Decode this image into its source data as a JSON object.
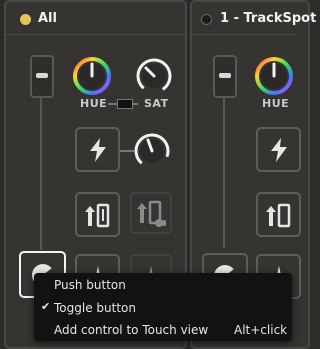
{
  "panels": [
    {
      "title": "All",
      "indicator_color": "#e6c25a"
    },
    {
      "title": "1 - TrackSpot",
      "indicator_color": "#1b1b1b"
    }
  ],
  "labels": {
    "hue": "HUE",
    "sat": "SAT",
    "hue_partial": "HUE"
  },
  "context_menu": {
    "items": [
      {
        "label": "Push button",
        "checked": false,
        "shortcut": ""
      },
      {
        "label": "Toggle button",
        "checked": true,
        "check_glyph": "✔",
        "shortcut": ""
      },
      {
        "label": "Add control to Touch view",
        "checked": false,
        "shortcut": "Alt+click"
      }
    ]
  },
  "colors": {
    "panel_bg": "#353431",
    "panel_border": "#4a4844",
    "menu_bg": "#121212",
    "selected_outline": "#f4f4f4",
    "accent_yellow": "#e6c25a"
  },
  "icons": [
    "lightning-icon",
    "dimmer-icon",
    "fan-icon",
    "star-burst-icon",
    "check-icon"
  ]
}
